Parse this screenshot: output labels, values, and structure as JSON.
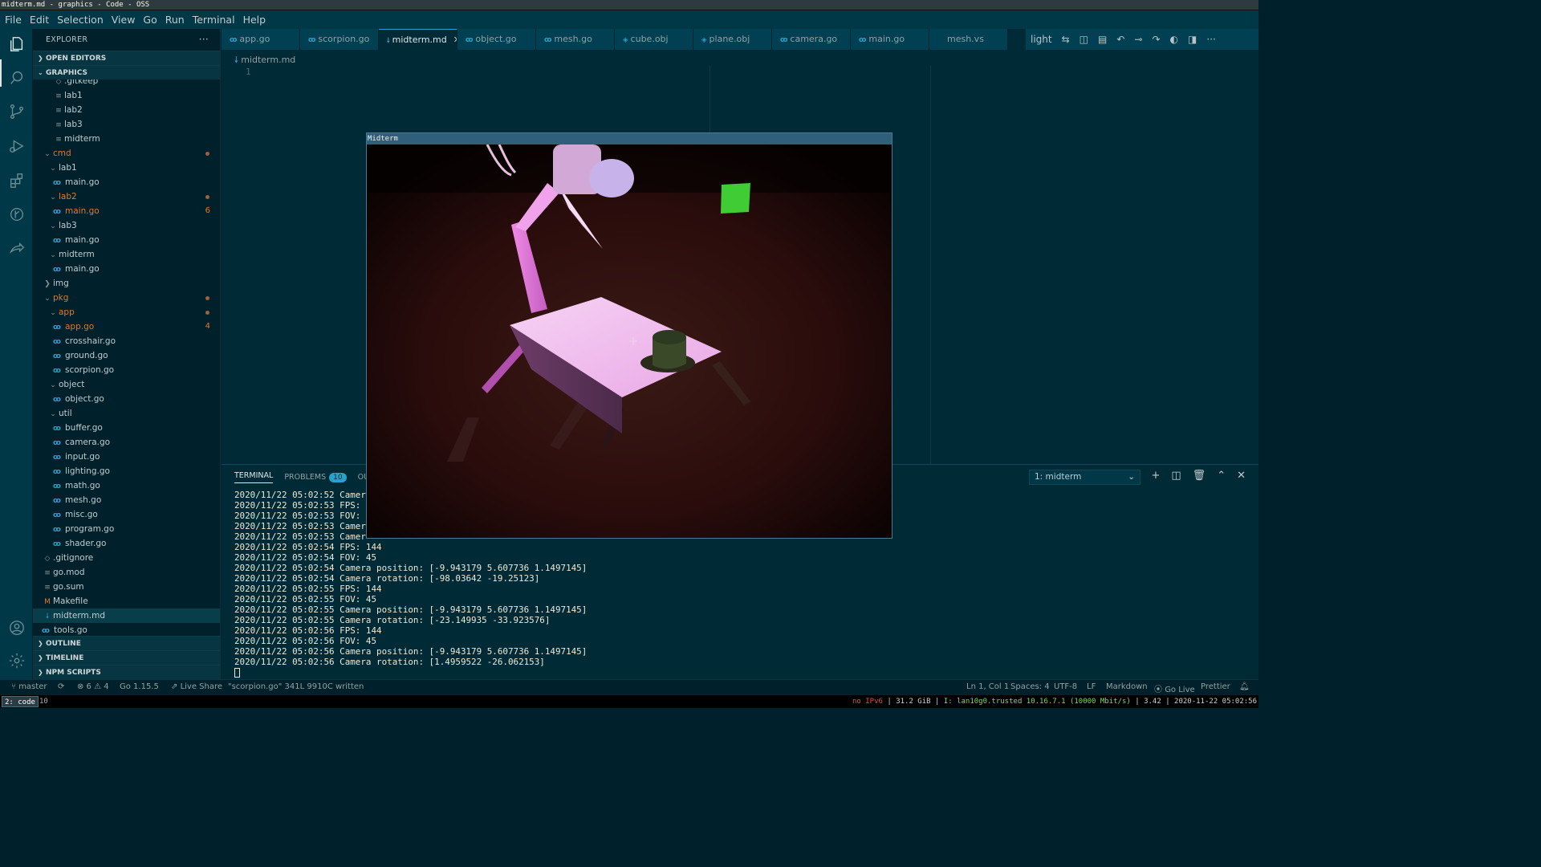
{
  "window_title": "midterm.md - graphics - Code - OSS",
  "menu": [
    "File",
    "Edit",
    "Selection",
    "View",
    "Go",
    "Run",
    "Terminal",
    "Help"
  ],
  "activity_icons": [
    "explorer-icon",
    "search-icon",
    "source-control-icon",
    "run-debug-icon",
    "extensions-icon",
    "git-graph-icon",
    "live-share-icon",
    "accounts-icon",
    "settings-gear-icon"
  ],
  "sidebar": {
    "title": "EXPLORER",
    "open_editors": "OPEN EDITORS",
    "workspace": "GRAPHICS",
    "tree": [
      {
        "name": ".gitkeep",
        "type": "file"
      },
      {
        "name": "lab1",
        "type": "doc"
      },
      {
        "name": "lab2",
        "type": "doc"
      },
      {
        "name": "lab3",
        "type": "doc"
      },
      {
        "name": "midterm",
        "type": "doc"
      },
      {
        "name": "cmd",
        "type": "folder",
        "modified": true
      },
      {
        "name": "lab1",
        "type": "folder"
      },
      {
        "name": "main.go",
        "type": "go"
      },
      {
        "name": "lab2",
        "type": "folder",
        "modified": true
      },
      {
        "name": "main.go",
        "type": "go",
        "modified": true,
        "badge": "6"
      },
      {
        "name": "lab3",
        "type": "folder"
      },
      {
        "name": "main.go",
        "type": "go"
      },
      {
        "name": "midterm",
        "type": "folder"
      },
      {
        "name": "main.go",
        "type": "go"
      },
      {
        "name": "img",
        "type": "folder-closed"
      },
      {
        "name": "pkg",
        "type": "folder",
        "modified": true
      },
      {
        "name": "app",
        "type": "folder",
        "modified": true
      },
      {
        "name": "app.go",
        "type": "go",
        "modified": true,
        "badge": "4"
      },
      {
        "name": "crosshair.go",
        "type": "go"
      },
      {
        "name": "ground.go",
        "type": "go"
      },
      {
        "name": "scorpion.go",
        "type": "go"
      },
      {
        "name": "object",
        "type": "folder"
      },
      {
        "name": "object.go",
        "type": "go"
      },
      {
        "name": "util",
        "type": "folder"
      },
      {
        "name": "buffer.go",
        "type": "go"
      },
      {
        "name": "camera.go",
        "type": "go"
      },
      {
        "name": "input.go",
        "type": "go"
      },
      {
        "name": "lighting.go",
        "type": "go"
      },
      {
        "name": "math.go",
        "type": "go"
      },
      {
        "name": "mesh.go",
        "type": "go"
      },
      {
        "name": "misc.go",
        "type": "go"
      },
      {
        "name": "program.go",
        "type": "go"
      },
      {
        "name": "shader.go",
        "type": "go"
      },
      {
        "name": ".gitignore",
        "type": "file"
      },
      {
        "name": "go.mod",
        "type": "doc"
      },
      {
        "name": "go.sum",
        "type": "doc"
      },
      {
        "name": "Makefile",
        "type": "make"
      },
      {
        "name": "midterm.md",
        "type": "md",
        "selected": true
      },
      {
        "name": "tools.go",
        "type": "go"
      }
    ],
    "outline": "OUTLINE",
    "timeline": "TIMELINE",
    "npm_scripts": "NPM SCRIPTS"
  },
  "tabs": [
    {
      "label": "app.go",
      "icon": "go"
    },
    {
      "label": "scorpion.go",
      "icon": "go"
    },
    {
      "label": "midterm.md",
      "icon": "md",
      "active": true
    },
    {
      "label": "object.go",
      "icon": "go"
    },
    {
      "label": "mesh.go",
      "icon": "go"
    },
    {
      "label": "cube.obj",
      "icon": "obj"
    },
    {
      "label": "plane.obj",
      "icon": "obj"
    },
    {
      "label": "camera.go",
      "icon": "go"
    },
    {
      "label": "main.go",
      "icon": "go"
    },
    {
      "label": "mesh.vs",
      "icon": "none"
    }
  ],
  "tab_overflow_label": "light",
  "editor": {
    "breadcrumb": "midterm.md",
    "line_number": "1"
  },
  "panel": {
    "terminal_tab": "TERMINAL",
    "problems_tab": "PROBLEMS",
    "problems_count": "10",
    "output_tab": "OUT",
    "terminal_select": "1: midterm",
    "lines": [
      "2020/11/22 05:02:52 Camer",
      "2020/11/22 05:02:53 FPS:",
      "2020/11/22 05:02:53 FOV:",
      "2020/11/22 05:02:53 Camer",
      "2020/11/22 05:02:53 Camer",
      "2020/11/22 05:02:54 FPS: 144",
      "2020/11/22 05:02:54 FOV: 45",
      "2020/11/22 05:02:54 Camera position: [-9.943179 5.607736 1.1497145]",
      "2020/11/22 05:02:54 Camera rotation: [-98.03642 -19.25123]",
      "2020/11/22 05:02:55 FPS: 144",
      "2020/11/22 05:02:55 FOV: 45",
      "2020/11/22 05:02:55 Camera position: [-9.943179 5.607736 1.1497145]",
      "2020/11/22 05:02:55 Camera rotation: [-23.149935 -33.923576]",
      "2020/11/22 05:02:56 FPS: 144",
      "2020/11/22 05:02:56 FOV: 45",
      "2020/11/22 05:02:56 Camera position: [-9.943179 5.607736 1.1497145]",
      "2020/11/22 05:02:56 Camera rotation: [1.4959522 -26.062153]"
    ]
  },
  "statusbar": {
    "branch": "master",
    "problems": "⊗ 6 ⚠ 4",
    "go_version": "Go 1.15.5",
    "live_share": "Live Share",
    "message": "\"scorpion.go\" 341L 9910C written",
    "position": "Ln 1, Col 1",
    "spaces": "Spaces: 4",
    "encoding": "UTF-8",
    "eol": "LF",
    "language": "Markdown",
    "go_live": "Go Live",
    "prettier": "Prettier"
  },
  "wm": {
    "workspace_active": "2: code",
    "workspace_other": "10",
    "ipv6": "no IPv6",
    "disk": "31.2 GiB",
    "network": "I: lan10g0.trusted 10.16.7.1 (10000 Mbit/s)",
    "load": "3.42",
    "datetime": "2020-11-22 05:02:56"
  },
  "gl_window": {
    "title": "Midterm"
  },
  "colors": {
    "accent": "#2aa1c8",
    "modified": "#dc7a37",
    "background": "#002b36"
  }
}
